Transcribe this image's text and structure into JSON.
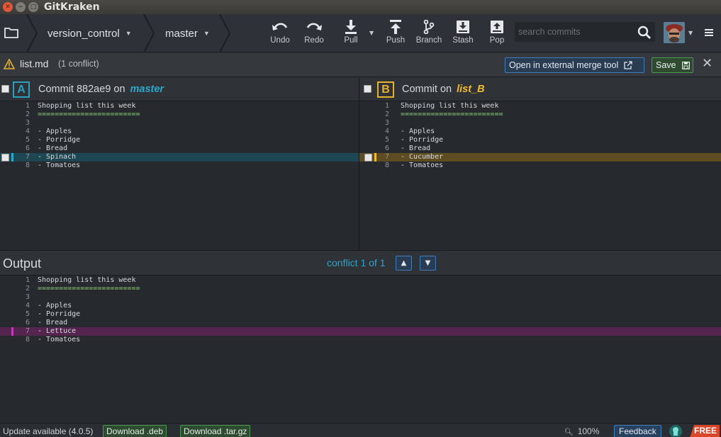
{
  "window": {
    "title": "GitKraken"
  },
  "toolbar": {
    "repo": "version_control",
    "branch": "master",
    "actions": [
      {
        "label": "Undo",
        "icon": "undo-icon"
      },
      {
        "label": "Redo",
        "icon": "redo-icon"
      },
      {
        "label": "Pull",
        "icon": "pull-icon"
      },
      {
        "label": "Push",
        "icon": "push-icon"
      },
      {
        "label": "Branch",
        "icon": "branch-icon"
      },
      {
        "label": "Stash",
        "icon": "stash-icon"
      },
      {
        "label": "Pop",
        "icon": "pop-icon"
      }
    ],
    "search_placeholder": "search commits"
  },
  "file": {
    "name": "list.md",
    "conflict_count": "(1 conflict)",
    "external_tool_label": "Open in external merge tool",
    "save_label": "Save"
  },
  "pane_a": {
    "badge": "A",
    "commit_prefix": "Commit 882ae9 on",
    "branch": "master",
    "lines": [
      {
        "n": "1",
        "text": "Shopping list this week"
      },
      {
        "n": "2",
        "text": "========================"
      },
      {
        "n": "3",
        "text": ""
      },
      {
        "n": "4",
        "text": "- Apples"
      },
      {
        "n": "5",
        "text": "- Porridge"
      },
      {
        "n": "6",
        "text": "- Bread"
      },
      {
        "n": "7",
        "text": "- Spinach"
      },
      {
        "n": "8",
        "text": "- Tomatoes"
      }
    ]
  },
  "pane_b": {
    "badge": "B",
    "commit_prefix": "Commit on",
    "branch": "list_B",
    "lines": [
      {
        "n": "1",
        "text": "Shopping list this week"
      },
      {
        "n": "2",
        "text": "========================"
      },
      {
        "n": "3",
        "text": ""
      },
      {
        "n": "4",
        "text": "- Apples"
      },
      {
        "n": "5",
        "text": "- Porridge"
      },
      {
        "n": "6",
        "text": "- Bread"
      },
      {
        "n": "7",
        "text": "- Cucumber"
      },
      {
        "n": "8",
        "text": "- Tomatoes"
      }
    ]
  },
  "output": {
    "title": "Output",
    "conflict_nav": "conflict 1 of 1",
    "lines": [
      {
        "n": "1",
        "text": "Shopping list this week"
      },
      {
        "n": "2",
        "text": "========================"
      },
      {
        "n": "3",
        "text": ""
      },
      {
        "n": "4",
        "text": "- Apples"
      },
      {
        "n": "5",
        "text": "- Porridge"
      },
      {
        "n": "6",
        "text": "- Bread"
      },
      {
        "n": "7",
        "text": "- Lettuce"
      },
      {
        "n": "8",
        "text": "- Tomatoes"
      }
    ]
  },
  "status": {
    "update_text": "Update available (4.0.5)",
    "download_deb": "Download .deb",
    "download_tar": "Download .tar.gz",
    "zoom": "100%",
    "feedback": "Feedback",
    "plan": "FREE"
  },
  "colors": {
    "accent_a": "#2ba8c8",
    "accent_b": "#f0bc2c",
    "output_highlight": "#c03db8",
    "save_green": "#4c9a52",
    "free_badge": "#d9462a"
  }
}
